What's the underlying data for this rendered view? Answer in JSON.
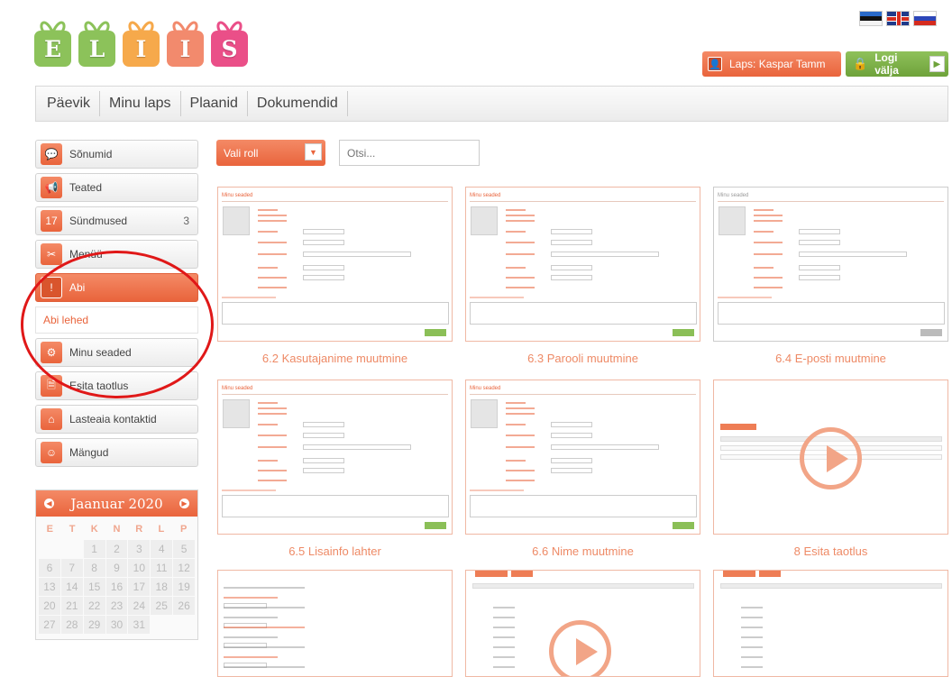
{
  "header": {
    "logo_letters": [
      "E",
      "L",
      "I",
      "I",
      "S"
    ],
    "logo_colors": [
      "#8cc25a",
      "#8cc25a",
      "#f6a94b",
      "#f28a6d",
      "#ea4f88"
    ],
    "languages": [
      "Eesti",
      "English",
      "Русский"
    ],
    "child_button": "Laps: Kaspar Tamm",
    "logout_button": "Logi välja"
  },
  "nav": {
    "items": [
      "Päevik",
      "Minu laps",
      "Plaanid",
      "Dokumendid"
    ]
  },
  "sidebar": {
    "items": [
      {
        "label": "Sõnumid",
        "icon": "speech-bubble-icon",
        "glyph": "💬",
        "count": ""
      },
      {
        "label": "Teated",
        "icon": "megaphone-icon",
        "glyph": "📢",
        "count": ""
      },
      {
        "label": "Sündmused",
        "icon": "calendar-icon",
        "glyph": "17",
        "count": "3"
      },
      {
        "label": "Menüü",
        "icon": "fork-knife-icon",
        "glyph": "✂",
        "count": ""
      },
      {
        "label": "Abi",
        "icon": "exclamation-icon",
        "glyph": "!",
        "count": "",
        "active": true
      },
      {
        "label": "Minu seaded",
        "icon": "gears-icon",
        "glyph": "⚙",
        "count": ""
      },
      {
        "label": "Esita taotlus",
        "icon": "document-icon",
        "glyph": "🗎",
        "count": ""
      },
      {
        "label": "Lasteaia kontaktid",
        "icon": "house-icon",
        "glyph": "⌂",
        "count": ""
      },
      {
        "label": "Mängud",
        "icon": "smiley-icon",
        "glyph": "☺",
        "count": ""
      }
    ],
    "sub_item": "Abi lehed"
  },
  "calendar": {
    "title": "Jaanuar 2020",
    "weekdays": [
      "E",
      "T",
      "K",
      "N",
      "R",
      "L",
      "P"
    ],
    "cells": [
      "",
      "",
      "1",
      "2",
      "3",
      "4",
      "5",
      "6",
      "7",
      "8",
      "9",
      "10",
      "11",
      "12",
      "13",
      "14",
      "15",
      "16",
      "17",
      "18",
      "19",
      "20",
      "21",
      "22",
      "23",
      "24",
      "25",
      "26",
      "27",
      "28",
      "29",
      "30",
      "31",
      "",
      ""
    ]
  },
  "toolbar": {
    "role_select": "Vali roll",
    "search_placeholder": "Otsi..."
  },
  "help_cards": [
    {
      "caption": "6.2 Kasutajanime muutmine",
      "mini_title": "Minu seaded"
    },
    {
      "caption": "6.3 Parooli muutmine",
      "mini_title": "Minu seaded"
    },
    {
      "caption": "6.4 E-posti muutmine",
      "mini_title": "Minu seaded"
    },
    {
      "caption": "6.5 Lisainfo lahter",
      "mini_title": "Minu seaded"
    },
    {
      "caption": "6.6 Nime muutmine",
      "mini_title": "Minu seaded"
    },
    {
      "caption": "8 Esita taotlus",
      "mini_title": ""
    },
    {
      "caption": "",
      "mini_title": ""
    },
    {
      "caption": "",
      "mini_title": ""
    },
    {
      "caption": "",
      "mini_title": ""
    }
  ],
  "colors": {
    "accent_orange": "#e9643c",
    "accent_green": "#6ea23a",
    "annotation_red": "#e01818"
  }
}
